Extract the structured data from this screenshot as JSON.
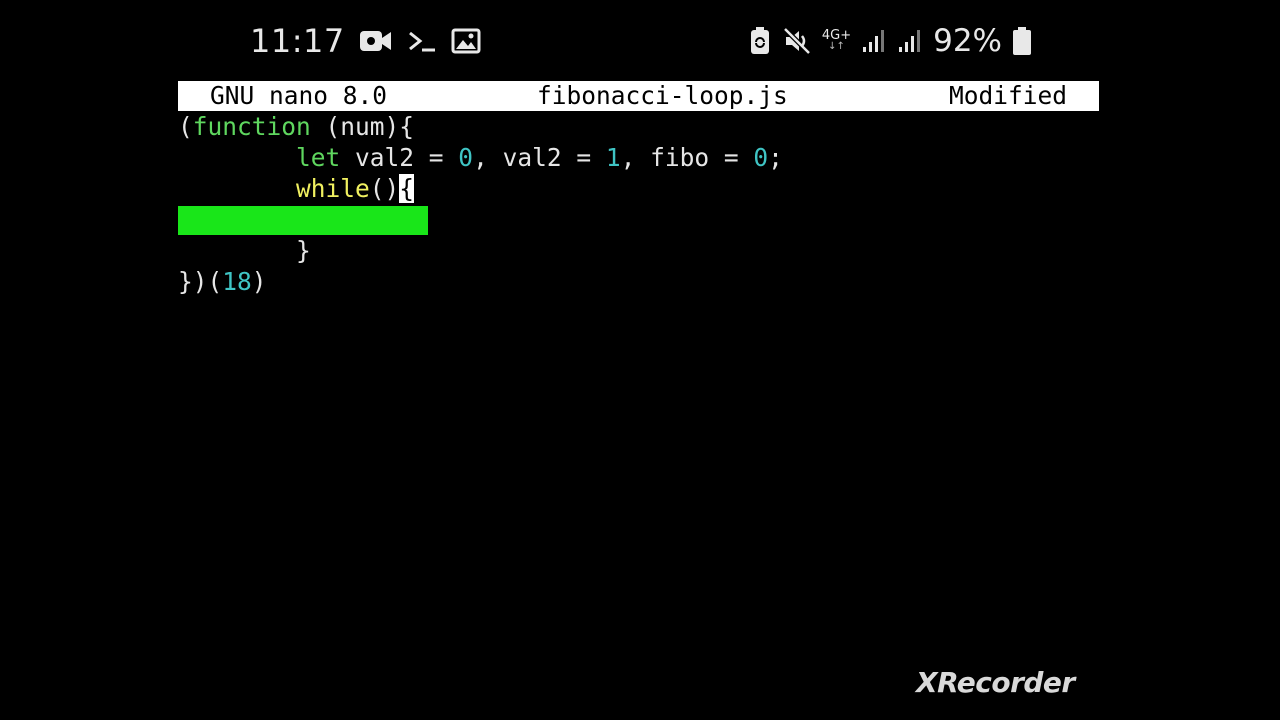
{
  "status_bar": {
    "time": "11:17",
    "left_icons": [
      "video-camera-icon",
      "terminal-icon",
      "image-icon"
    ],
    "right_icons": [
      "battery-saver-icon",
      "mute-icon",
      "signal-icon",
      "signal-icon"
    ],
    "network": "4G+",
    "battery_percent": "92%"
  },
  "nano": {
    "title_left": "GNU nano 8.0",
    "filename": "fibonacci-loop.js",
    "state": "Modified",
    "lines": {
      "l1_open": "(",
      "l1_kw": "function",
      "l1_rest": " (num){",
      "l2_indent": "        ",
      "l2_kw": "let",
      "l2_a": " val2 = ",
      "l2_n1": "0",
      "l2_b": ", val2 = ",
      "l2_n2": "1",
      "l2_c": ", fibo = ",
      "l2_n3": "0",
      "l2_d": ";",
      "l3_indent": "        ",
      "l3_kw": "while",
      "l3_rest": "()",
      "l3_cursor": "{",
      "l5_indent": "        ",
      "l5_text": "}",
      "l6_a": "})(",
      "l6_num": "18",
      "l6_b": ")"
    },
    "colors": {
      "keyword_green": "#5fd75f",
      "keyword_yellow": "#f0f060",
      "number_cyan": "#3fc4c4",
      "highlight_green": "#19e619"
    }
  },
  "watermark": "XRecorder"
}
